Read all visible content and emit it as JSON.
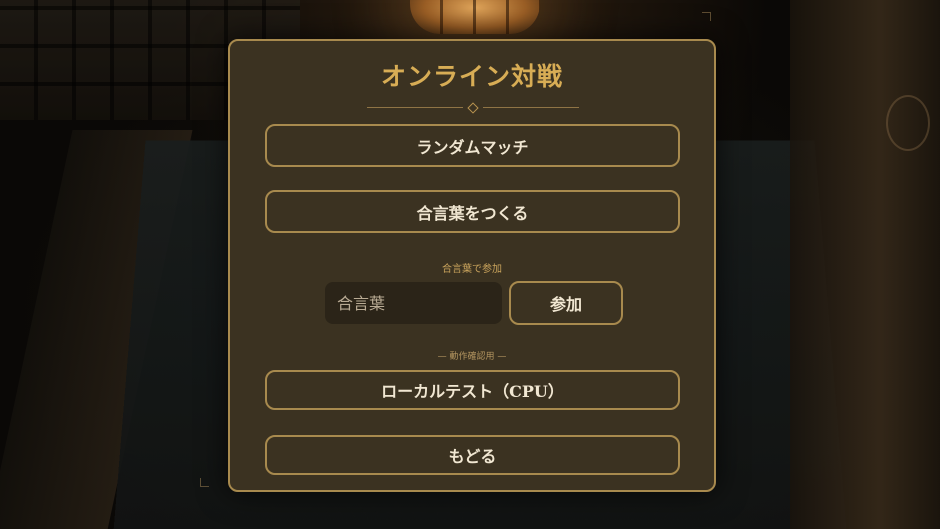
{
  "panel": {
    "title": "オンライン対戦",
    "random_match_label": "ランダムマッチ",
    "create_passphrase_label": "合言葉をつくる",
    "join_section_label": "合言葉で参加",
    "join_input": {
      "value": "",
      "placeholder": "合言葉"
    },
    "join_button_label": "参加",
    "debug_section_label": "— 動作確認用 —",
    "local_test_label": "ローカルテスト（CPU）",
    "back_label": "もどる"
  },
  "colors": {
    "panel_bg": "#3b3221",
    "border_gold": "#a88a4e",
    "title_gold": "#d8ad55",
    "button_text": "#f1e7d2",
    "input_bg": "#2b2418"
  },
  "icons": {
    "title_divider": "diamond-ornament",
    "background_crest": "family-crest-icon"
  }
}
